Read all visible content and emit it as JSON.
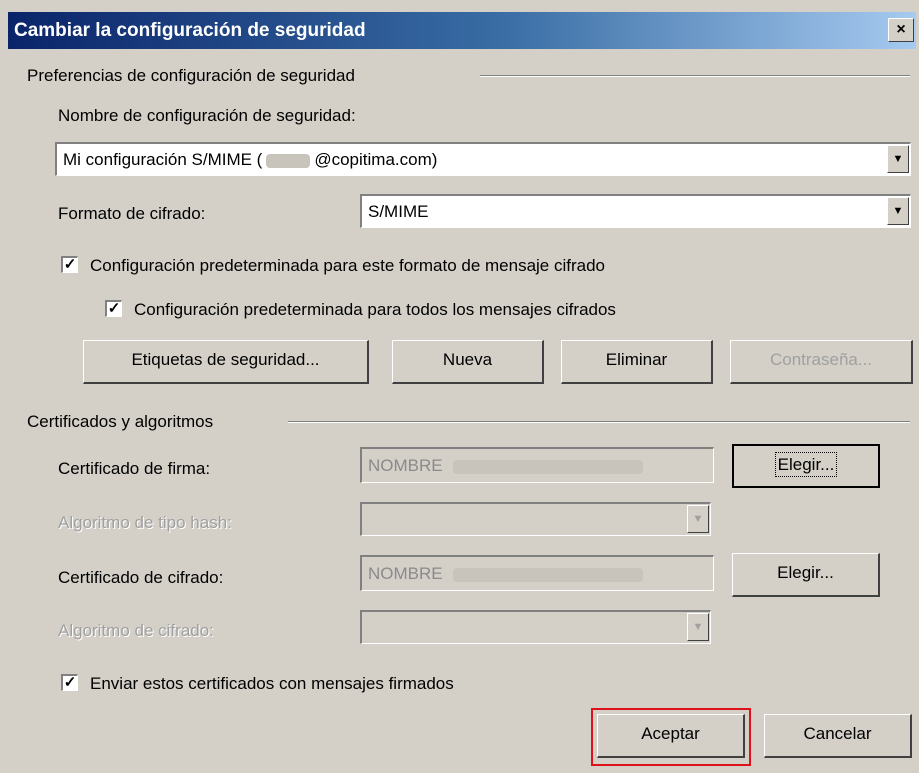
{
  "window": {
    "title": "Cambiar la configuración de seguridad",
    "close_label": "×"
  },
  "prefs": {
    "group_label": "Preferencias de configuración de seguridad",
    "name_label": "Nombre de configuración de seguridad:",
    "name_value_prefix": "Mi configuración S/MIME (",
    "name_value_suffix": "@copitima.com)",
    "format_label": "Formato de cifrado:",
    "format_value": "S/MIME",
    "default_format_checkbox": {
      "label": "Configuración predeterminada para este formato de mensaje cifrado",
      "checked": true
    },
    "default_all_checkbox": {
      "label": "Configuración predeterminada para todos los mensajes cifrados",
      "checked": true
    },
    "buttons": {
      "security_labels": "Etiquetas de seguridad...",
      "new": "Nueva",
      "delete": "Eliminar",
      "password": "Contraseña..."
    }
  },
  "certs": {
    "group_label": "Certificados y algoritmos",
    "signing_label": "Certificado de firma:",
    "signing_value": "NOMBRE",
    "hash_label": "Algoritmo de tipo hash:",
    "encryption_label": "Certificado de cifrado:",
    "encryption_value": "NOMBRE",
    "enc_algorithm_label": "Algoritmo de cifrado:",
    "choose_label": "Elegir...",
    "send_certs_checkbox": {
      "label": "Enviar estos certificados con mensajes firmados",
      "checked": true
    }
  },
  "footer": {
    "ok": "Aceptar",
    "cancel": "Cancelar"
  },
  "colors": {
    "title_start": "#0a246a",
    "title_end": "#a6caf0",
    "dialog_bg": "#d4d0c8",
    "highlight": "#e0101c"
  },
  "icons": {
    "dropdown": "chevron-down-icon",
    "check": "check-icon",
    "close": "close-icon"
  }
}
